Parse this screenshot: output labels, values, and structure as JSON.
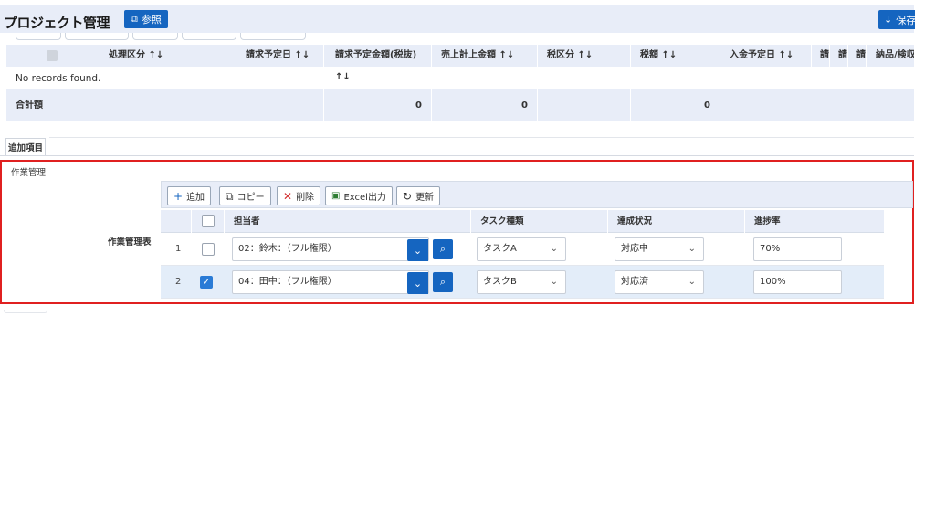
{
  "header": {
    "title": "プロジェクト管理",
    "ref_button": "参照",
    "save_button": "保存"
  },
  "upper_table": {
    "columns": [
      "処理区分 ↑↓",
      "請求予定日 ↑↓",
      "請求予定金額(税抜) ↑↓",
      "売上計上金額 ↑↓",
      "税区分 ↑↓",
      "税額 ↑↓",
      "入金予定日 ↑↓",
      "請",
      "請",
      "請",
      "納品/検収"
    ],
    "empty_message": "No records found.",
    "total_label": "合計額",
    "totals": [
      "0",
      "0",
      "0"
    ]
  },
  "section_tab": "追加項目",
  "work": {
    "section_label": "作業管理",
    "table_label": "作業管理表",
    "toolbar": {
      "add": "追加",
      "copy": "コピー",
      "delete": "削除",
      "excel": "Excel出力",
      "refresh": "更新"
    },
    "columns": {
      "assignee": "担当者",
      "task_type": "タスク種類",
      "status": "達成状況",
      "progress": "進捗率"
    },
    "rows": [
      {
        "no": "1",
        "checked": false,
        "assignee": "02：鈴木：（フル権限）",
        "task_type": "タスクA",
        "status": "対応中",
        "progress": "70%"
      },
      {
        "no": "2",
        "checked": true,
        "assignee": "04：田中：（フル権限）",
        "task_type": "タスクB",
        "status": "対応済",
        "progress": "100%"
      }
    ]
  },
  "colors": {
    "primary": "#1565c0",
    "header_bg": "#e8edf8",
    "highlight_border": "#e02020",
    "selected_row": "#e3edf9"
  }
}
